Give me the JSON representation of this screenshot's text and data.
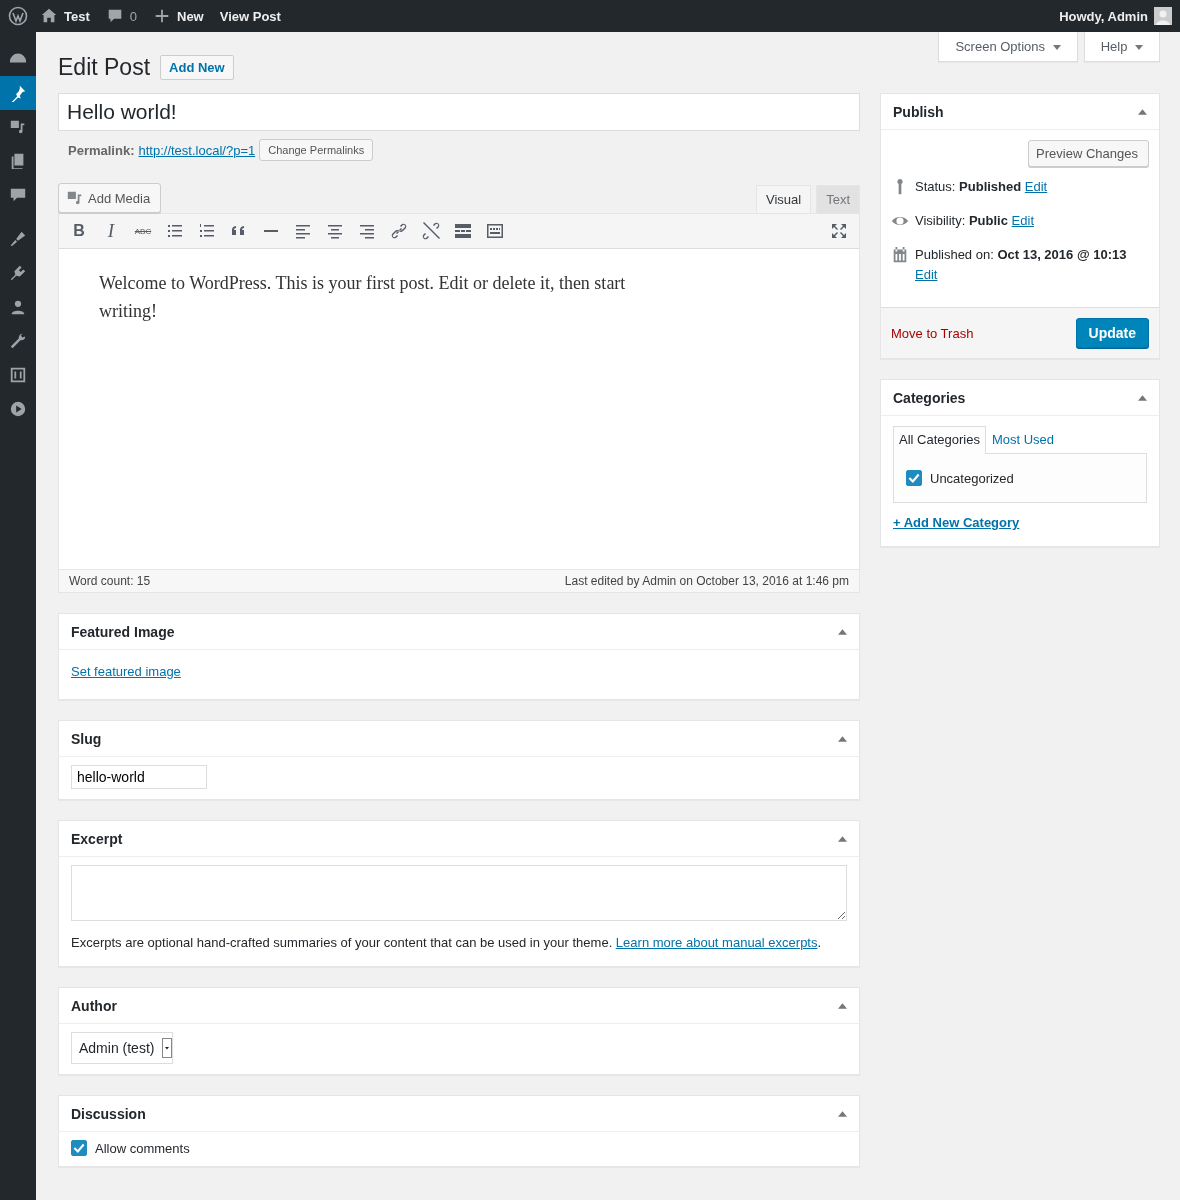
{
  "admin_bar": {
    "site_name": "Test",
    "comments_count": "0",
    "new_label": "New",
    "view_post": "View Post",
    "greeting": "Howdy, Admin"
  },
  "sidebar": {
    "items": [
      {
        "kind": "dashboard",
        "selected": false
      },
      {
        "kind": "posts",
        "selected": true
      },
      {
        "kind": "media",
        "selected": false
      },
      {
        "kind": "pages",
        "selected": false
      },
      {
        "kind": "comments",
        "selected": false
      },
      {
        "kind": "appearance",
        "selected": false
      },
      {
        "kind": "plugins",
        "selected": false
      },
      {
        "kind": "users",
        "selected": false
      },
      {
        "kind": "tools",
        "selected": false
      },
      {
        "kind": "settings",
        "selected": false
      },
      {
        "kind": "video",
        "selected": false
      }
    ]
  },
  "screen_meta": [
    "Screen Options",
    "Help"
  ],
  "header": {
    "title": "Edit Post",
    "add_new": "Add New"
  },
  "post": {
    "title": "Hello world!",
    "permalink_label": "Permalink:",
    "permalink_url": "http://test.local/?p=1",
    "change_permalinks": "Change Permalinks"
  },
  "editor": {
    "add_media": "Add Media",
    "tabs": [
      {
        "label": "Visual",
        "selected": true
      },
      {
        "label": "Text",
        "selected": false
      }
    ],
    "toolbar": [
      {
        "kind": "bold",
        "glyph": "B"
      },
      {
        "kind": "italic",
        "glyph": "I"
      },
      {
        "kind": "strikethrough",
        "glyph": "ABC"
      },
      {
        "kind": "bullet-list"
      },
      {
        "kind": "numbered-list"
      },
      {
        "kind": "blockquote"
      },
      {
        "kind": "horizontal-line"
      },
      {
        "kind": "align-left"
      },
      {
        "kind": "align-center"
      },
      {
        "kind": "align-right"
      },
      {
        "kind": "link"
      },
      {
        "kind": "unlink"
      },
      {
        "kind": "read-more"
      },
      {
        "kind": "toolbar-toggle"
      }
    ],
    "content": "Welcome to WordPress. This is your first post. Edit or delete it, then start writing!",
    "word_count": "Word count: 15",
    "last_edited": "Last edited by Admin on October 13, 2016 at 1:46 pm"
  },
  "featured_image": {
    "title": "Featured Image",
    "link": "Set featured image"
  },
  "slug": {
    "title": "Slug",
    "value": "hello-world"
  },
  "excerpt": {
    "title": "Excerpt",
    "help": "Excerpts are optional hand-crafted summaries of your content that can be used in your theme.",
    "link": "Learn more about manual excerpts",
    "after": "."
  },
  "author": {
    "title": "Author",
    "value": "Admin (test)"
  },
  "discussion": {
    "title": "Discussion",
    "options": [
      {
        "label": "Allow comments",
        "checked": true
      }
    ]
  },
  "publish": {
    "title": "Publish",
    "preview": "Preview Changes",
    "rows": [
      {
        "kind": "status",
        "text": "Status: **Published**",
        "link": "Edit"
      },
      {
        "kind": "visibility",
        "text": "Visibility: **Public**",
        "link": "Edit"
      },
      {
        "kind": "date",
        "text": "Published on: **Oct 13, 2016 @ 10:13**",
        "link": "Edit"
      }
    ],
    "trash": "Move to Trash",
    "update": "Update"
  },
  "categories": {
    "title": "Categories",
    "tabs": [
      {
        "label": "All Categories",
        "selected": true
      },
      {
        "label": "Most Used",
        "selected": false
      }
    ],
    "items": [
      {
        "label": "Uncategorized",
        "checked": true
      }
    ],
    "add_new": "+ Add New Category"
  }
}
